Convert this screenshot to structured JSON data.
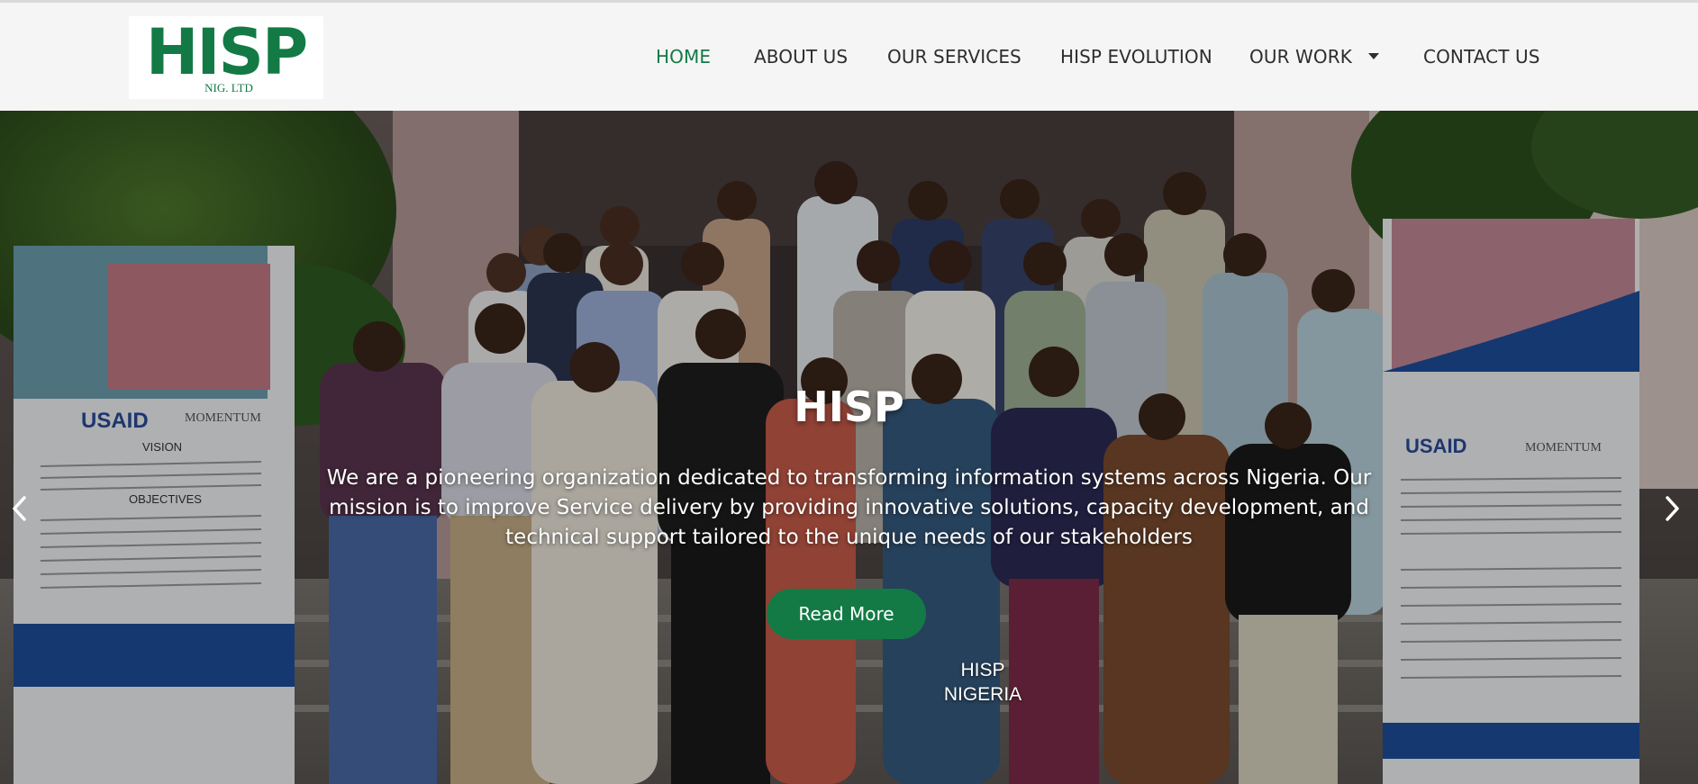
{
  "logo": {
    "text": "HISP",
    "subtext": "NIG. LTD",
    "brand_color": "#137a45"
  },
  "nav": {
    "items": [
      {
        "label": "HOME",
        "active": true
      },
      {
        "label": "ABOUT US"
      },
      {
        "label": "OUR SERVICES"
      },
      {
        "label": "HISP EVOLUTION"
      },
      {
        "label": "OUR WORK",
        "dropdown": true
      },
      {
        "label": "CONTACT US"
      }
    ]
  },
  "hero": {
    "title": "HISP",
    "description": "We are a pioneering organization dedicated to transforming information systems across Nigeria. Our mission is to improve Service delivery by providing innovative solutions, capacity development, and technical support tailored to the unique needs of our stakeholders",
    "button_label": "Read More",
    "caption_line1": "HISP",
    "caption_line2": "NIGERIA",
    "left_banner_brand": "USAID",
    "left_banner_partner": "MOMENTUM",
    "left_banner_heading1": "VISION",
    "left_banner_heading2": "OBJECTIVES",
    "right_banner_brand": "USAID",
    "right_banner_partner": "MOMENTUM",
    "prev_icon": "chevron-left-icon",
    "next_icon": "chevron-right-icon"
  }
}
